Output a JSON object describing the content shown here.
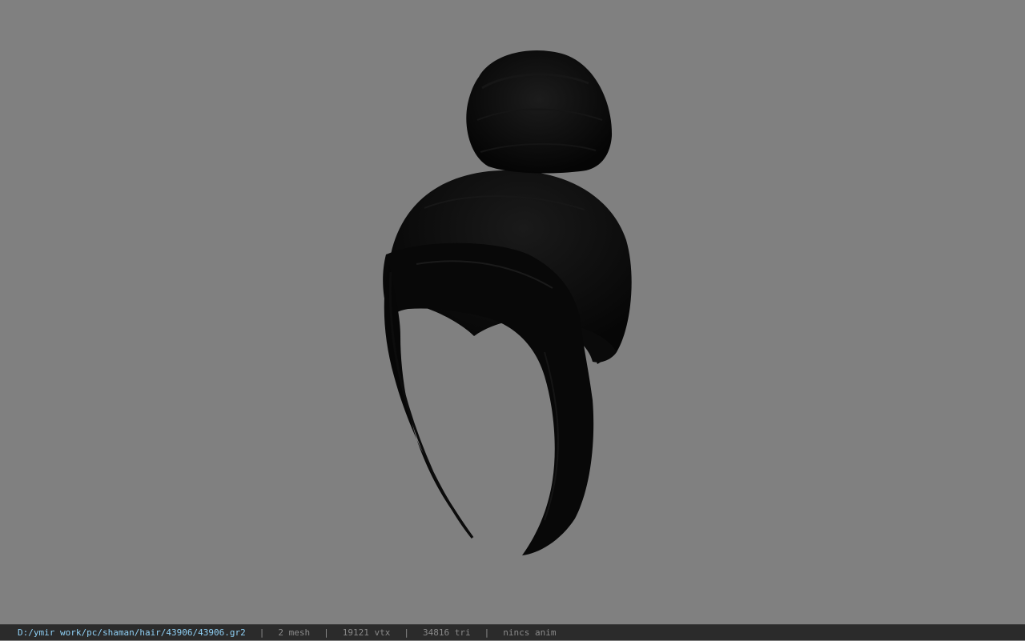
{
  "viewport": {
    "background_color": "#808080",
    "model": "hair-mesh"
  },
  "status_bar": {
    "file_path": "D:/ymir work/pc/shaman/hair/43906/43906.gr2",
    "separator": "|",
    "mesh_count": "2 mesh",
    "vertex_count": "19121 vtx",
    "triangle_count": "34816 tri",
    "animation": "nincs anim",
    "path_color": "#8fd0f5",
    "text_color": "#8a8a8a"
  }
}
